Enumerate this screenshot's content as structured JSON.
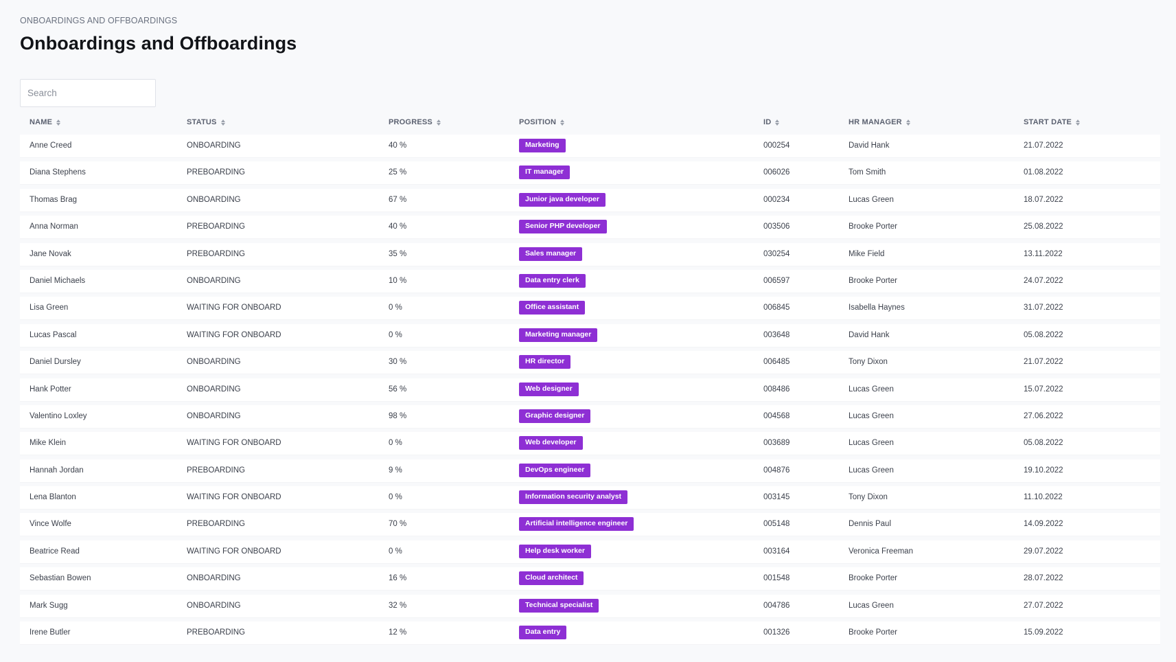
{
  "breadcrumb": "ONBOARDINGS AND OFFBOARDINGS",
  "title": "Onboardings and Offboardings",
  "search": {
    "placeholder": "Search",
    "value": ""
  },
  "colors": {
    "badge": "#8e2fd4",
    "background": "#f8f9fb",
    "row": "#ffffff"
  },
  "columns": {
    "name": "NAME",
    "status": "STATUS",
    "progress": "PROGRESS",
    "position": "POSITION",
    "id": "ID",
    "hr": "HR MANAGER",
    "date": "START DATE"
  },
  "rows": [
    {
      "name": "Anne Creed",
      "status": "ONBOARDING",
      "progress": "40 %",
      "position": "Marketing",
      "id": "000254",
      "hr": "David Hank",
      "date": "21.07.2022"
    },
    {
      "name": "Diana Stephens",
      "status": "PREBOARDING",
      "progress": "25 %",
      "position": "IT manager",
      "id": "006026",
      "hr": "Tom Smith",
      "date": "01.08.2022"
    },
    {
      "name": "Thomas Brag",
      "status": "ONBOARDING",
      "progress": "67 %",
      "position": "Junior java developer",
      "id": "000234",
      "hr": "Lucas Green",
      "date": "18.07.2022"
    },
    {
      "name": "Anna Norman",
      "status": "PREBOARDING",
      "progress": "40 %",
      "position": "Senior PHP developer",
      "id": "003506",
      "hr": "Brooke Porter",
      "date": "25.08.2022"
    },
    {
      "name": "Jane Novak",
      "status": "PREBOARDING",
      "progress": "35 %",
      "position": "Sales manager",
      "id": "030254",
      "hr": "Mike Field",
      "date": "13.11.2022"
    },
    {
      "name": "Daniel Michaels",
      "status": "ONBOARDING",
      "progress": "10 %",
      "position": "Data entry clerk",
      "id": "006597",
      "hr": "Brooke Porter",
      "date": "24.07.2022"
    },
    {
      "name": "Lisa Green",
      "status": "WAITING FOR ONBOARD",
      "progress": "0 %",
      "position": "Office assistant",
      "id": "006845",
      "hr": "Isabella Haynes",
      "date": "31.07.2022"
    },
    {
      "name": "Lucas Pascal",
      "status": "WAITING FOR ONBOARD",
      "progress": "0 %",
      "position": "Marketing manager",
      "id": "003648",
      "hr": "David Hank",
      "date": "05.08.2022"
    },
    {
      "name": "Daniel Dursley",
      "status": "ONBOARDING",
      "progress": "30 %",
      "position": "HR director",
      "id": "006485",
      "hr": "Tony Dixon",
      "date": "21.07.2022"
    },
    {
      "name": "Hank Potter",
      "status": "ONBOARDING",
      "progress": "56 %",
      "position": "Web designer",
      "id": "008486",
      "hr": "Lucas Green",
      "date": "15.07.2022"
    },
    {
      "name": "Valentino Loxley",
      "status": "ONBOARDING",
      "progress": "98 %",
      "position": "Graphic designer",
      "id": "004568",
      "hr": "Lucas Green",
      "date": "27.06.2022"
    },
    {
      "name": "Mike Klein",
      "status": "WAITING FOR ONBOARD",
      "progress": "0 %",
      "position": "Web developer",
      "id": "003689",
      "hr": "Lucas Green",
      "date": "05.08.2022"
    },
    {
      "name": "Hannah Jordan",
      "status": "PREBOARDING",
      "progress": "9 %",
      "position": "DevOps engineer",
      "id": "004876",
      "hr": "Lucas Green",
      "date": "19.10.2022"
    },
    {
      "name": "Lena Blanton",
      "status": "WAITING FOR ONBOARD",
      "progress": "0 %",
      "position": "Information security analyst",
      "id": "003145",
      "hr": "Tony Dixon",
      "date": "11.10.2022"
    },
    {
      "name": "Vince Wolfe",
      "status": "PREBOARDING",
      "progress": "70 %",
      "position": "Artificial intelligence engineer",
      "id": "005148",
      "hr": "Dennis Paul",
      "date": "14.09.2022"
    },
    {
      "name": "Beatrice Read",
      "status": "WAITING FOR ONBOARD",
      "progress": "0 %",
      "position": "Help desk worker",
      "id": "003164",
      "hr": "Veronica Freeman",
      "date": "29.07.2022"
    },
    {
      "name": "Sebastian Bowen",
      "status": "ONBOARDING",
      "progress": "16 %",
      "position": "Cloud architect",
      "id": "001548",
      "hr": "Brooke Porter",
      "date": "28.07.2022"
    },
    {
      "name": "Mark Sugg",
      "status": "ONBOARDING",
      "progress": "32 %",
      "position": "Technical specialist",
      "id": "004786",
      "hr": "Lucas Green",
      "date": "27.07.2022"
    },
    {
      "name": "Irene Butler",
      "status": "PREBOARDING",
      "progress": "12 %",
      "position": "Data entry",
      "id": "001326",
      "hr": "Brooke Porter",
      "date": "15.09.2022"
    }
  ]
}
